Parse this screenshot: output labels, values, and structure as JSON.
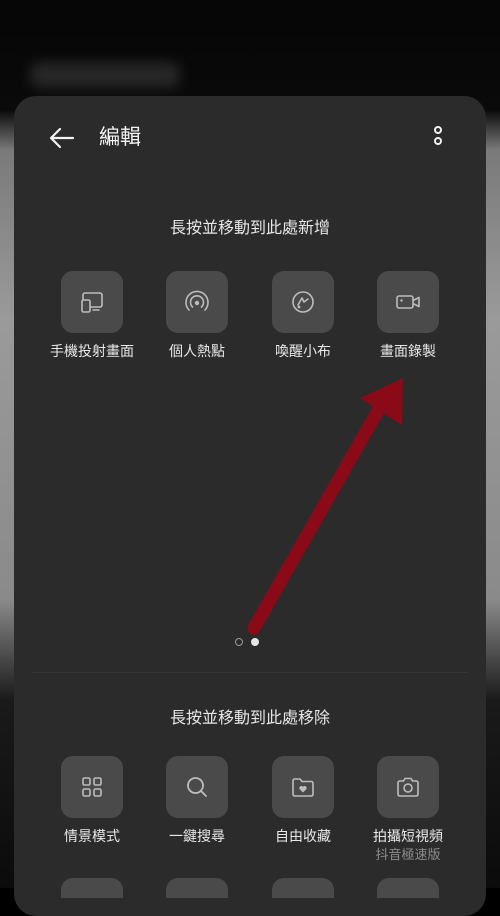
{
  "header": {
    "title": "編輯"
  },
  "add_section": {
    "label": "長按並移動到此處新增",
    "tiles": [
      {
        "label": "手機投射畫面",
        "icon": "screen-cast-icon"
      },
      {
        "label": "個人熱點",
        "icon": "hotspot-icon"
      },
      {
        "label": "喚醒小布",
        "icon": "breeno-icon"
      },
      {
        "label": "畫面錄製",
        "icon": "screen-record-icon"
      }
    ]
  },
  "pager": {
    "page_count": 2,
    "active_page": 2
  },
  "remove_section": {
    "label": "長按並移動到此處移除",
    "tiles": [
      {
        "label": "情景模式",
        "icon": "grid-icon"
      },
      {
        "label": "一鍵搜尋",
        "icon": "search-icon"
      },
      {
        "label": "自由收藏",
        "icon": "favorite-folder-icon"
      },
      {
        "label": "拍攝短視頻",
        "sublabel": "抖音極速版",
        "icon": "camera-icon"
      }
    ]
  },
  "colors": {
    "sheet": "#2b2b2b",
    "tile": "#4a4a4a",
    "annotation_arrow": "#8b0a17"
  }
}
